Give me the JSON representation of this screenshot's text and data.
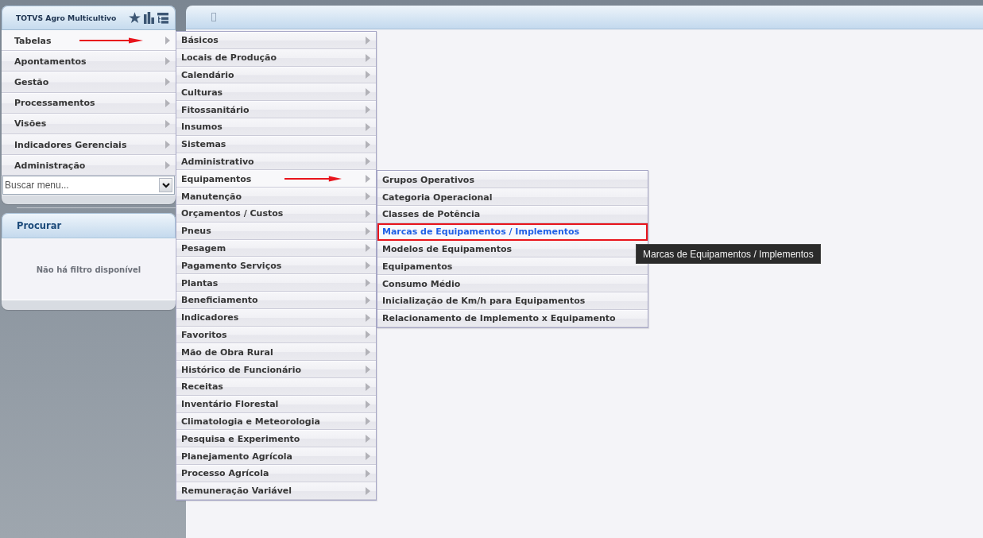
{
  "app": {
    "title": "TOTVS Agro Multicultivo"
  },
  "menu": {
    "items": [
      {
        "label": "Tabelas",
        "submenu": true,
        "expanded": true,
        "arrow": true,
        "children": [
          {
            "label": "Básicos",
            "submenu": true,
            "expanded": false,
            "arrow": false
          },
          {
            "label": "Locais de Produção",
            "submenu": true,
            "expanded": false,
            "arrow": false
          },
          {
            "label": "Calendário",
            "submenu": true,
            "expanded": false,
            "arrow": false
          },
          {
            "label": "Culturas",
            "submenu": true,
            "expanded": false,
            "arrow": false
          },
          {
            "label": "Fitossanitário",
            "submenu": true,
            "expanded": false,
            "arrow": false
          },
          {
            "label": "Insumos",
            "submenu": true,
            "expanded": false,
            "arrow": false
          },
          {
            "label": "Sistemas",
            "submenu": true,
            "expanded": false,
            "arrow": false
          },
          {
            "label": "Administrativo",
            "submenu": true,
            "expanded": false,
            "arrow": false
          },
          {
            "label": "Equipamentos",
            "submenu": true,
            "expanded": true,
            "arrow": true,
            "children": [
              {
                "label": "Grupos Operativos",
                "submenu": false,
                "selected": false
              },
              {
                "label": "Categoria Operacional",
                "submenu": false,
                "selected": false
              },
              {
                "label": "Classes de Potência",
                "submenu": false,
                "selected": false
              },
              {
                "label": "Marcas de Equipamentos / Implementos",
                "submenu": false,
                "selected": true
              },
              {
                "label": "Modelos de Equipamentos",
                "submenu": false,
                "selected": false
              },
              {
                "label": "Equipamentos",
                "submenu": false,
                "selected": false
              },
              {
                "label": "Consumo Médio",
                "submenu": false,
                "selected": false
              },
              {
                "label": "Inicialização de Km/h para Equipamentos",
                "submenu": false,
                "selected": false
              },
              {
                "label": "Relacionamento de Implemento x Equipamento",
                "submenu": false,
                "selected": false
              }
            ]
          },
          {
            "label": "Manutenção",
            "submenu": true,
            "expanded": false,
            "arrow": false
          },
          {
            "label": "Orçamentos / Custos",
            "submenu": true,
            "expanded": false,
            "arrow": false
          },
          {
            "label": "Pneus",
            "submenu": true,
            "expanded": false,
            "arrow": false
          },
          {
            "label": "Pesagem",
            "submenu": true,
            "expanded": false,
            "arrow": false
          },
          {
            "label": "Pagamento Serviços",
            "submenu": true,
            "expanded": false,
            "arrow": false
          },
          {
            "label": "Plantas",
            "submenu": true,
            "expanded": false,
            "arrow": false
          },
          {
            "label": "Beneficiamento",
            "submenu": true,
            "expanded": false,
            "arrow": false
          },
          {
            "label": "Indicadores",
            "submenu": true,
            "expanded": false,
            "arrow": false
          },
          {
            "label": "Favoritos",
            "submenu": true,
            "expanded": false,
            "arrow": false
          },
          {
            "label": "Mão de Obra Rural",
            "submenu": true,
            "expanded": false,
            "arrow": false
          },
          {
            "label": "Histórico de Funcionário",
            "submenu": true,
            "expanded": false,
            "arrow": false
          },
          {
            "label": "Receitas",
            "submenu": true,
            "expanded": false,
            "arrow": false
          },
          {
            "label": "Inventário Florestal",
            "submenu": true,
            "expanded": false,
            "arrow": false
          },
          {
            "label": "Climatologia e Meteorologia",
            "submenu": true,
            "expanded": false,
            "arrow": false
          },
          {
            "label": "Pesquisa e Experimento",
            "submenu": true,
            "expanded": false,
            "arrow": false
          },
          {
            "label": "Planejamento Agrícola",
            "submenu": true,
            "expanded": false,
            "arrow": false
          },
          {
            "label": "Processo Agrícola",
            "submenu": true,
            "expanded": false,
            "arrow": false
          },
          {
            "label": "Remuneração Variável",
            "submenu": true,
            "expanded": false,
            "arrow": false
          }
        ]
      },
      {
        "label": "Apontamentos",
        "submenu": true,
        "expanded": false,
        "arrow": false
      },
      {
        "label": "Gestão",
        "submenu": true,
        "expanded": false,
        "arrow": false
      },
      {
        "label": "Processamentos",
        "submenu": true,
        "expanded": false,
        "arrow": false
      },
      {
        "label": "Visões",
        "submenu": true,
        "expanded": false,
        "arrow": false
      },
      {
        "label": "Indicadores Gerenciais",
        "submenu": true,
        "expanded": false,
        "arrow": false
      },
      {
        "label": "Administração",
        "submenu": true,
        "expanded": false,
        "arrow": false
      }
    ]
  },
  "search": {
    "placeholder": "Buscar menu..."
  },
  "filter_panel": {
    "title": "Procurar",
    "message": "Não há filtro disponível"
  },
  "tooltip": {
    "text": "Marcas de Equipamentos / Implementos"
  }
}
